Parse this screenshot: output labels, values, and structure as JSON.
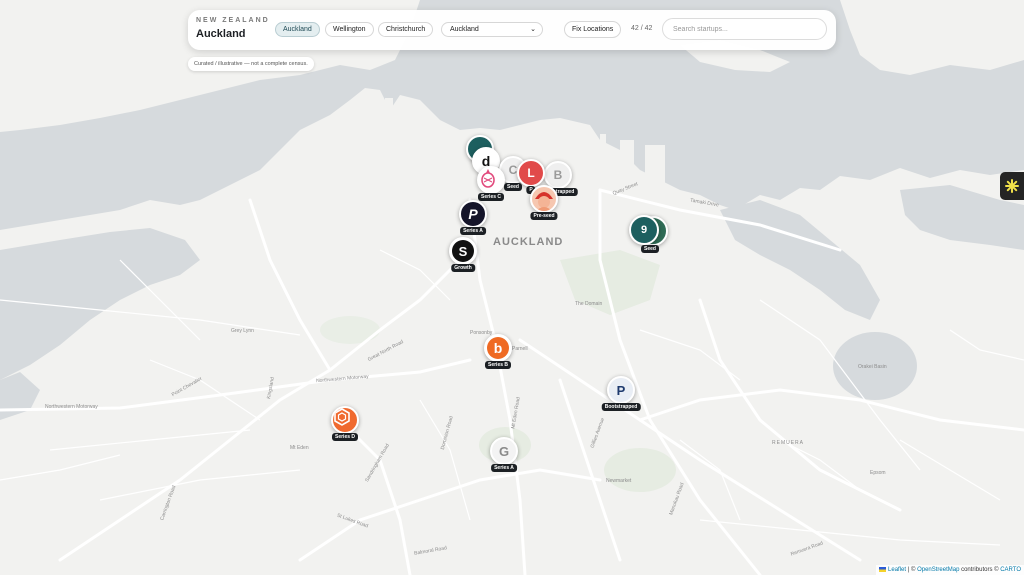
{
  "header": {
    "kicker": "NEW ZEALAND",
    "city": "Auckland",
    "city_tabs": [
      {
        "label": "Auckland",
        "active": true
      },
      {
        "label": "Wellington",
        "active": false
      },
      {
        "label": "Christchurch",
        "active": false
      }
    ],
    "region_select": "Auckland",
    "fix_locations_label": "Fix Locations",
    "count": "42 / 42",
    "search_placeholder": "Search startups..."
  },
  "disclaimer": "Curated / illustrative — not a complete census.",
  "map_labels": {
    "city": "AUCKLAND",
    "the_domain": "The Domain",
    "remuera": "REMUERA",
    "orakei_basin": "Orakei Basin",
    "quay_street": "Quay Street",
    "tamaki_drive": "Tamaki Drive",
    "northwestern_motorway": "Northwestern Motorway",
    "great_north_road": "Great North Road",
    "dominion_road": "Dominion Road",
    "balmoral_road": "Balmoral Road",
    "manukau_road": "Manukau Road",
    "remuera_road": "Remuera Road",
    "gillies_avenue": "Gillies Avenue",
    "sandringham_road": "Sandringham Road",
    "st_lukes_road": "St Lukes Road",
    "carrington_road": "Carrington Road",
    "mt_eden_road": "Mt Eden Road",
    "newmarket": "Newmarket",
    "point_chevalier": "Point Chevalier",
    "grey_lynn": "Grey Lynn",
    "ponsonby": "Ponsonby",
    "parnell": "Parnell",
    "epsom": "Epsom",
    "mt_eden": "Mt Eden",
    "kingsland": "Kingsland"
  },
  "markers": [
    {
      "id": "teal-top",
      "tag": ""
    },
    {
      "id": "dark-d",
      "tag": ""
    },
    {
      "id": "pineapple",
      "tag": "Series C"
    },
    {
      "id": "gray-c",
      "tag": "Seed"
    },
    {
      "id": "red-l",
      "tag": "P"
    },
    {
      "id": "gray-b",
      "tag": "Bootstrapped"
    },
    {
      "id": "avatar",
      "tag": "Pre-seed"
    },
    {
      "id": "p-dark",
      "tag": "Series A"
    },
    {
      "id": "s-black",
      "tag": "Growth"
    },
    {
      "id": "b-orange",
      "tag": "Series B"
    },
    {
      "id": "p-blue",
      "tag": "Bootstrapped"
    },
    {
      "id": "hex-orange",
      "tag": "Series D"
    },
    {
      "id": "g-gray",
      "tag": "Series A"
    }
  ],
  "clusters": [
    {
      "count": "9",
      "tag": "Seed"
    }
  ],
  "attribution": {
    "leaflet": "Leaflet",
    "sep1": "| ©",
    "osm": "OpenStreetMap",
    "contributors": "contributors ©",
    "carto": "CARTO"
  },
  "colors": {
    "water": "#d6dadd",
    "land": "#f2f2f0",
    "park": "#e6ece2",
    "road": "#ffffff",
    "cluster": "#1d5f5f",
    "tag_bg": "#1c2024"
  }
}
